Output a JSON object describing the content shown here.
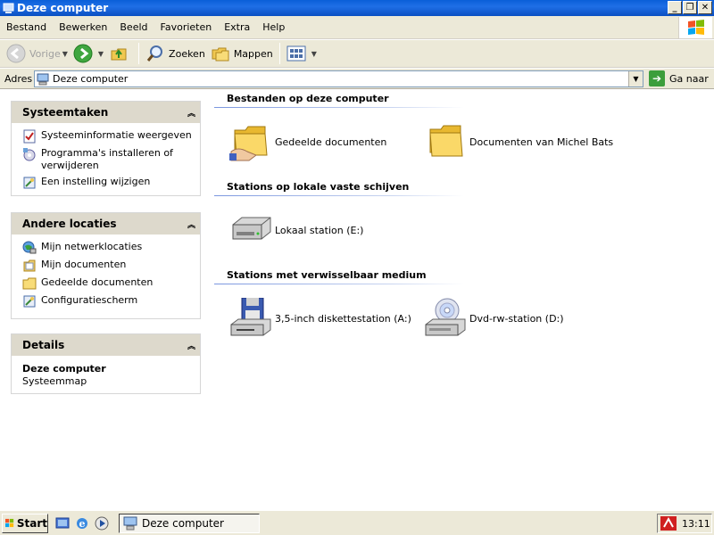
{
  "window": {
    "title": "Deze computer"
  },
  "menu": [
    "Bestand",
    "Bewerken",
    "Beeld",
    "Favorieten",
    "Extra",
    "Help"
  ],
  "toolbar": {
    "back": "Vorige",
    "search": "Zoeken",
    "folders": "Mappen"
  },
  "address": {
    "label": "Adres",
    "value": "Deze computer",
    "go": "Ga naar"
  },
  "tasks": {
    "title": "Systeemtaken",
    "items": [
      "Systeeminformatie weergeven",
      "Programma's installeren of verwijderen",
      "Een instelling wijzigen"
    ]
  },
  "places": {
    "title": "Andere locaties",
    "items": [
      "Mijn netwerklocaties",
      "Mijn documenten",
      "Gedeelde documenten",
      "Configuratiescherm"
    ]
  },
  "details": {
    "title": "Details",
    "name": "Deze computer",
    "type": "Systeemmap"
  },
  "groups": {
    "files": {
      "title": "Bestanden op deze computer",
      "items": [
        "Gedeelde documenten",
        "Documenten van Michel Bats"
      ]
    },
    "local": {
      "title": "Stations op lokale vaste schijven",
      "items": [
        "Lokaal station (E:)"
      ]
    },
    "removable": {
      "title": "Stations met verwisselbaar medium",
      "items": [
        "3,5-inch diskettestation (A:)",
        "Dvd-rw-station (D:)"
      ]
    }
  },
  "taskbar": {
    "start": "Start",
    "task": "Deze computer",
    "clock": "13:11"
  },
  "colors": {
    "titlebar": "#0a5fd8",
    "chrome": "#ece9d8",
    "pane_header": "#ddd9cc",
    "group_line": "#7a96df"
  }
}
